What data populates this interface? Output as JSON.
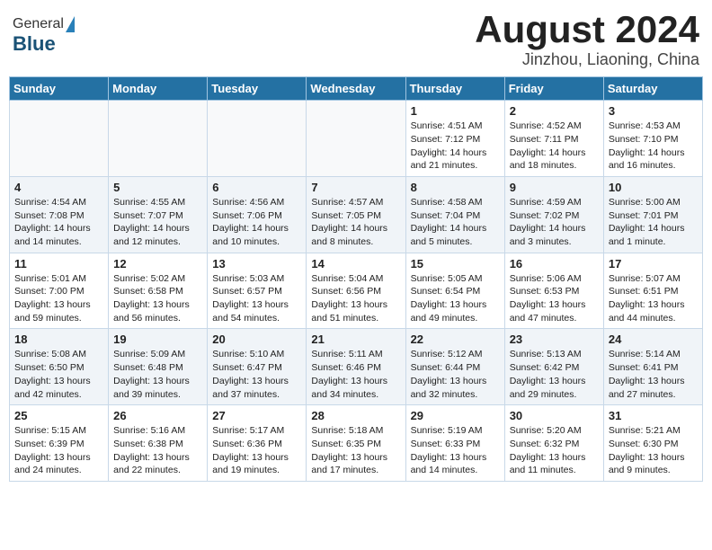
{
  "header": {
    "logo": {
      "general": "General",
      "blue": "Blue"
    },
    "title": "August 2024",
    "location": "Jinzhou, Liaoning, China"
  },
  "weekdays": [
    "Sunday",
    "Monday",
    "Tuesday",
    "Wednesday",
    "Thursday",
    "Friday",
    "Saturday"
  ],
  "weeks": [
    [
      {
        "day": "",
        "empty": true
      },
      {
        "day": "",
        "empty": true
      },
      {
        "day": "",
        "empty": true
      },
      {
        "day": "",
        "empty": true
      },
      {
        "day": "1",
        "sunrise": "Sunrise: 4:51 AM",
        "sunset": "Sunset: 7:12 PM",
        "daylight": "Daylight: 14 hours and 21 minutes."
      },
      {
        "day": "2",
        "sunrise": "Sunrise: 4:52 AM",
        "sunset": "Sunset: 7:11 PM",
        "daylight": "Daylight: 14 hours and 18 minutes."
      },
      {
        "day": "3",
        "sunrise": "Sunrise: 4:53 AM",
        "sunset": "Sunset: 7:10 PM",
        "daylight": "Daylight: 14 hours and 16 minutes."
      }
    ],
    [
      {
        "day": "4",
        "sunrise": "Sunrise: 4:54 AM",
        "sunset": "Sunset: 7:08 PM",
        "daylight": "Daylight: 14 hours and 14 minutes."
      },
      {
        "day": "5",
        "sunrise": "Sunrise: 4:55 AM",
        "sunset": "Sunset: 7:07 PM",
        "daylight": "Daylight: 14 hours and 12 minutes."
      },
      {
        "day": "6",
        "sunrise": "Sunrise: 4:56 AM",
        "sunset": "Sunset: 7:06 PM",
        "daylight": "Daylight: 14 hours and 10 minutes."
      },
      {
        "day": "7",
        "sunrise": "Sunrise: 4:57 AM",
        "sunset": "Sunset: 7:05 PM",
        "daylight": "Daylight: 14 hours and 8 minutes."
      },
      {
        "day": "8",
        "sunrise": "Sunrise: 4:58 AM",
        "sunset": "Sunset: 7:04 PM",
        "daylight": "Daylight: 14 hours and 5 minutes."
      },
      {
        "day": "9",
        "sunrise": "Sunrise: 4:59 AM",
        "sunset": "Sunset: 7:02 PM",
        "daylight": "Daylight: 14 hours and 3 minutes."
      },
      {
        "day": "10",
        "sunrise": "Sunrise: 5:00 AM",
        "sunset": "Sunset: 7:01 PM",
        "daylight": "Daylight: 14 hours and 1 minute."
      }
    ],
    [
      {
        "day": "11",
        "sunrise": "Sunrise: 5:01 AM",
        "sunset": "Sunset: 7:00 PM",
        "daylight": "Daylight: 13 hours and 59 minutes."
      },
      {
        "day": "12",
        "sunrise": "Sunrise: 5:02 AM",
        "sunset": "Sunset: 6:58 PM",
        "daylight": "Daylight: 13 hours and 56 minutes."
      },
      {
        "day": "13",
        "sunrise": "Sunrise: 5:03 AM",
        "sunset": "Sunset: 6:57 PM",
        "daylight": "Daylight: 13 hours and 54 minutes."
      },
      {
        "day": "14",
        "sunrise": "Sunrise: 5:04 AM",
        "sunset": "Sunset: 6:56 PM",
        "daylight": "Daylight: 13 hours and 51 minutes."
      },
      {
        "day": "15",
        "sunrise": "Sunrise: 5:05 AM",
        "sunset": "Sunset: 6:54 PM",
        "daylight": "Daylight: 13 hours and 49 minutes."
      },
      {
        "day": "16",
        "sunrise": "Sunrise: 5:06 AM",
        "sunset": "Sunset: 6:53 PM",
        "daylight": "Daylight: 13 hours and 47 minutes."
      },
      {
        "day": "17",
        "sunrise": "Sunrise: 5:07 AM",
        "sunset": "Sunset: 6:51 PM",
        "daylight": "Daylight: 13 hours and 44 minutes."
      }
    ],
    [
      {
        "day": "18",
        "sunrise": "Sunrise: 5:08 AM",
        "sunset": "Sunset: 6:50 PM",
        "daylight": "Daylight: 13 hours and 42 minutes."
      },
      {
        "day": "19",
        "sunrise": "Sunrise: 5:09 AM",
        "sunset": "Sunset: 6:48 PM",
        "daylight": "Daylight: 13 hours and 39 minutes."
      },
      {
        "day": "20",
        "sunrise": "Sunrise: 5:10 AM",
        "sunset": "Sunset: 6:47 PM",
        "daylight": "Daylight: 13 hours and 37 minutes."
      },
      {
        "day": "21",
        "sunrise": "Sunrise: 5:11 AM",
        "sunset": "Sunset: 6:46 PM",
        "daylight": "Daylight: 13 hours and 34 minutes."
      },
      {
        "day": "22",
        "sunrise": "Sunrise: 5:12 AM",
        "sunset": "Sunset: 6:44 PM",
        "daylight": "Daylight: 13 hours and 32 minutes."
      },
      {
        "day": "23",
        "sunrise": "Sunrise: 5:13 AM",
        "sunset": "Sunset: 6:42 PM",
        "daylight": "Daylight: 13 hours and 29 minutes."
      },
      {
        "day": "24",
        "sunrise": "Sunrise: 5:14 AM",
        "sunset": "Sunset: 6:41 PM",
        "daylight": "Daylight: 13 hours and 27 minutes."
      }
    ],
    [
      {
        "day": "25",
        "sunrise": "Sunrise: 5:15 AM",
        "sunset": "Sunset: 6:39 PM",
        "daylight": "Daylight: 13 hours and 24 minutes."
      },
      {
        "day": "26",
        "sunrise": "Sunrise: 5:16 AM",
        "sunset": "Sunset: 6:38 PM",
        "daylight": "Daylight: 13 hours and 22 minutes."
      },
      {
        "day": "27",
        "sunrise": "Sunrise: 5:17 AM",
        "sunset": "Sunset: 6:36 PM",
        "daylight": "Daylight: 13 hours and 19 minutes."
      },
      {
        "day": "28",
        "sunrise": "Sunrise: 5:18 AM",
        "sunset": "Sunset: 6:35 PM",
        "daylight": "Daylight: 13 hours and 17 minutes."
      },
      {
        "day": "29",
        "sunrise": "Sunrise: 5:19 AM",
        "sunset": "Sunset: 6:33 PM",
        "daylight": "Daylight: 13 hours and 14 minutes."
      },
      {
        "day": "30",
        "sunrise": "Sunrise: 5:20 AM",
        "sunset": "Sunset: 6:32 PM",
        "daylight": "Daylight: 13 hours and 11 minutes."
      },
      {
        "day": "31",
        "sunrise": "Sunrise: 5:21 AM",
        "sunset": "Sunset: 6:30 PM",
        "daylight": "Daylight: 13 hours and 9 minutes."
      }
    ]
  ]
}
